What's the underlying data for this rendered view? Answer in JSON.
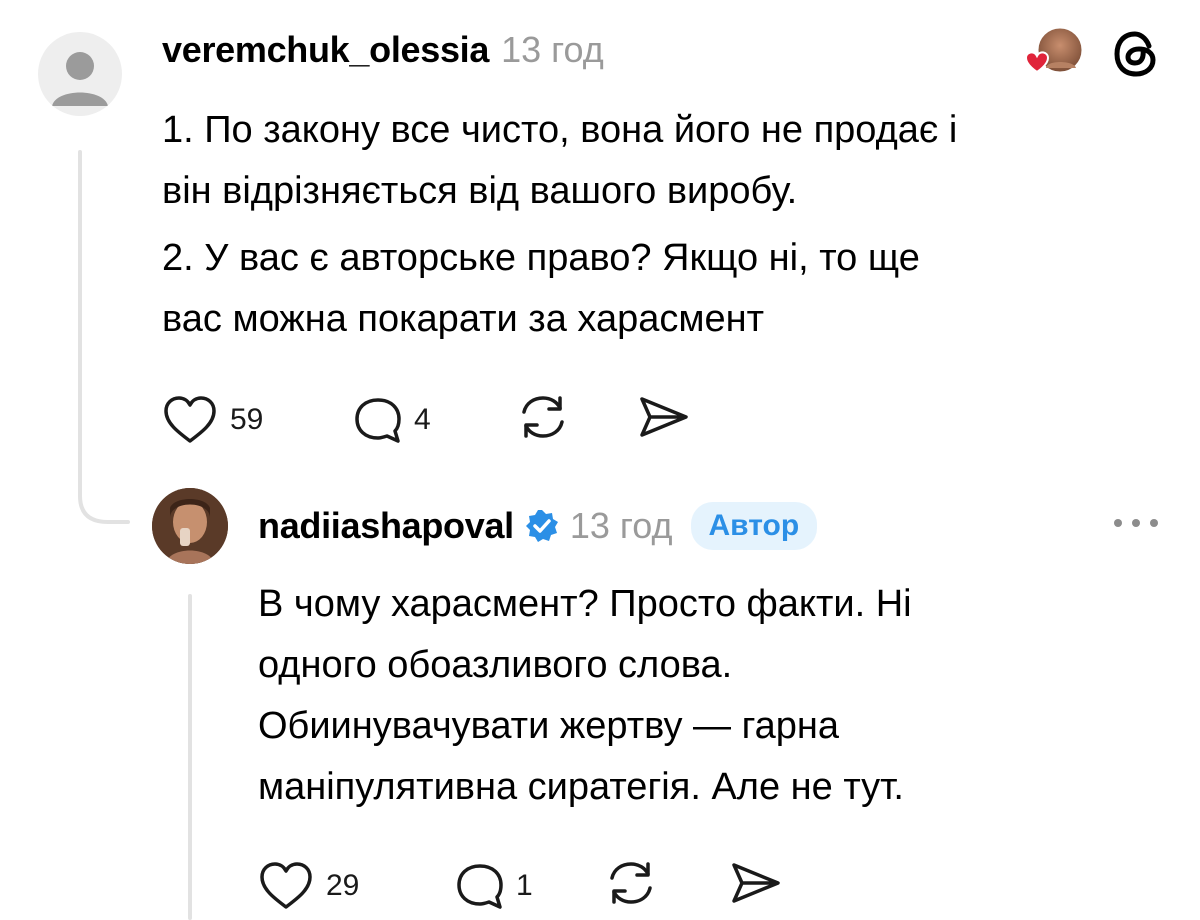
{
  "comment1": {
    "username": "veremchuk_olessia",
    "time": "13 год",
    "paragraphs": [
      "1. По закону все чисто, вона його не продає і він відрізняється від вашого виробу.",
      "2. У вас є авторське право? Якщо ні, то ще вас можна покарати за харасмент"
    ],
    "lines": [
      "1. По закону все чисто, вона його не продає і",
      "він відрізняється від вашого виробу.",
      "2. У вас є авторське право? Якщо ні, то ще",
      "вас можна покарати за харасмент"
    ],
    "likes": "59",
    "replies": "4"
  },
  "comment2": {
    "username": "nadiiashapoval",
    "time": "13 год",
    "badge": "Автор",
    "lines": [
      "В чому харасмент? Просто факти. Ні",
      "одного обоазливого слова.",
      "Обиинувачувати жертву — гарна",
      "маніпулятивна сиратегія. Але не тут."
    ],
    "likes": "29",
    "replies": "1"
  },
  "colors": {
    "accent": "#2b8fe6",
    "like_heart": "#e0243a",
    "muted": "#9a9a9a"
  },
  "icons": [
    "avatar-placeholder-icon",
    "liked-by-author-icon",
    "threads-logo-icon",
    "heart-icon",
    "comment-icon",
    "repost-icon",
    "share-icon",
    "verified-icon",
    "more-icon"
  ]
}
